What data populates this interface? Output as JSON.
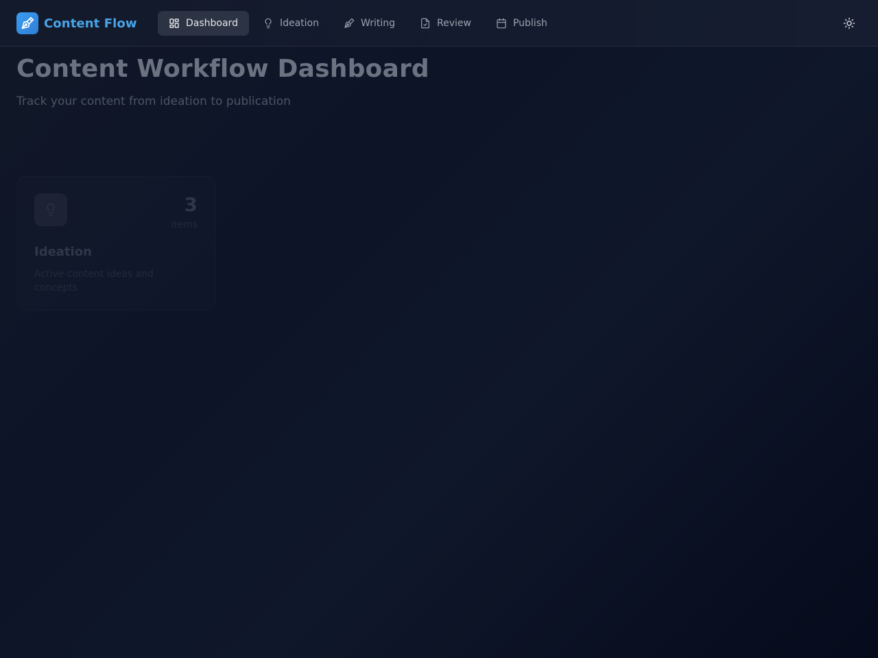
{
  "app": {
    "name": "Content Flow",
    "accent_color": "#3b9df0"
  },
  "nav": {
    "active": "Dashboard",
    "tabs": [
      {
        "label": "Dashboard",
        "icon": "dashboard-grid-icon"
      },
      {
        "label": "Ideation",
        "icon": "lightbulb-icon"
      },
      {
        "label": "Writing",
        "icon": "pen-nib-icon"
      },
      {
        "label": "Review",
        "icon": "file-check-icon"
      },
      {
        "label": "Publish",
        "icon": "calendar-icon"
      }
    ]
  },
  "header": {
    "theme_toggle_icon": "sun-icon"
  },
  "main": {
    "title": "Content Workflow Dashboard",
    "subtitle": "Track your content from ideation to publication",
    "cards": [
      {
        "title": "Ideation",
        "count": "3",
        "unit": "items",
        "description": "Active content ideas and concepts",
        "icon": "lightbulb-icon"
      }
    ]
  }
}
